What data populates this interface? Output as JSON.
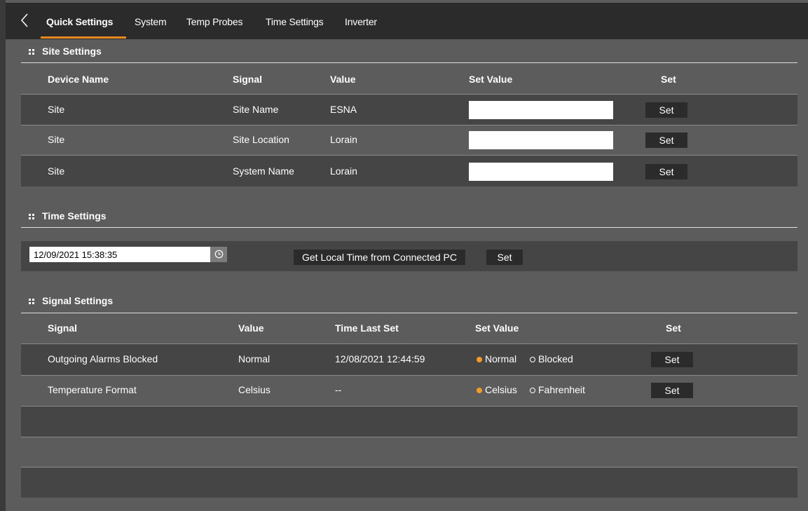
{
  "tabs": [
    {
      "label": "Quick Settings"
    },
    {
      "label": "System"
    },
    {
      "label": "Temp Probes"
    },
    {
      "label": "Time Settings"
    },
    {
      "label": "Inverter"
    }
  ],
  "active_tab": "Quick Settings",
  "colors": {
    "accent": "#e8891e",
    "tab_bar_bg": "#2b2b2b",
    "panel_bg": "#5c5c5c",
    "row_dark_bg": "#454545"
  },
  "site_settings": {
    "title": "Site Settings",
    "columns": [
      "Device Name",
      "Signal",
      "Value",
      "Set Value",
      "Set"
    ],
    "rows": [
      {
        "device": "Site",
        "signal": "Site Name",
        "value": "ESNA",
        "set_value": "",
        "button": "Set"
      },
      {
        "device": "Site",
        "signal": "Site Location",
        "value": "Lorain",
        "set_value": "",
        "button": "Set"
      },
      {
        "device": "Site",
        "signal": "System Name",
        "value": "Lorain",
        "set_value": "",
        "button": "Set"
      }
    ]
  },
  "time_settings": {
    "title": "Time Settings",
    "datetime_value": "12/09/2021 15:38:35",
    "get_local_time_label": "Get Local Time from Connected PC",
    "set_label": "Set"
  },
  "signal_settings": {
    "title": "Signal Settings",
    "columns": [
      "Signal",
      "Value",
      "Time Last Set",
      "Set Value",
      "Set"
    ],
    "rows": [
      {
        "signal": "Outgoing Alarms Blocked",
        "value": "Normal",
        "time_last_set": "12/08/2021 12:44:59",
        "options": [
          "Normal",
          "Blocked"
        ],
        "selected": "Normal",
        "button": "Set"
      },
      {
        "signal": "Temperature Format",
        "value": "Celsius",
        "time_last_set": "--",
        "options": [
          "Celsius",
          "Fahrenheit"
        ],
        "selected": "Celsius",
        "button": "Set"
      }
    ]
  },
  "icons": [
    "back-chevron-icon",
    "grip-icon",
    "clock-icon"
  ]
}
